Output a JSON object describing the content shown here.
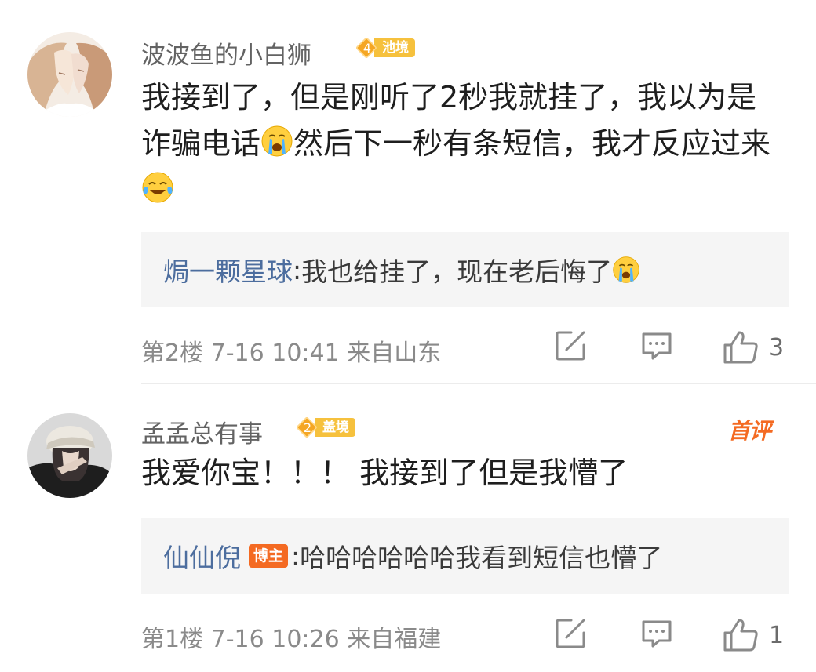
{
  "comments": [
    {
      "username": "波波鱼的小白狮",
      "level": "4",
      "level_name": "池境",
      "text_part1": "我接到了，但是刚听了2秒我就挂了，我以为是诈骗电话",
      "text_part2": "然后下一秒有条短信，我才反应过来",
      "emoji1": "crying-face-emoji",
      "emoji2": "laughing-tears-emoji",
      "reply": {
        "user": "焗一颗星球",
        "separator": ":",
        "text": " 我也给挂了，现在老后悔了",
        "emoji": "crying-face-emoji"
      },
      "floor": "第2楼",
      "time": "7-16 10:41",
      "location": "来自山东",
      "likes": "3"
    },
    {
      "username": "孟孟总有事",
      "level": "2",
      "level_name": "盖境",
      "badge": "首评",
      "text": "我爱你宝！！！ 我接到了但是我懵了",
      "reply": {
        "user": "仙仙倪",
        "host_badge": "博主",
        "separator": ":",
        "text": " 哈哈哈哈哈哈我看到短信也懵了"
      },
      "floor": "第1楼",
      "time": "7-16 10:26",
      "location": "来自福建",
      "likes": "1"
    }
  ],
  "colors": {
    "username": "#636363",
    "reply_user": "#4c6d9e",
    "host_badge": "#f46a22",
    "level_badge": "#f6c13d",
    "reply_bg": "#f5f5f5"
  }
}
